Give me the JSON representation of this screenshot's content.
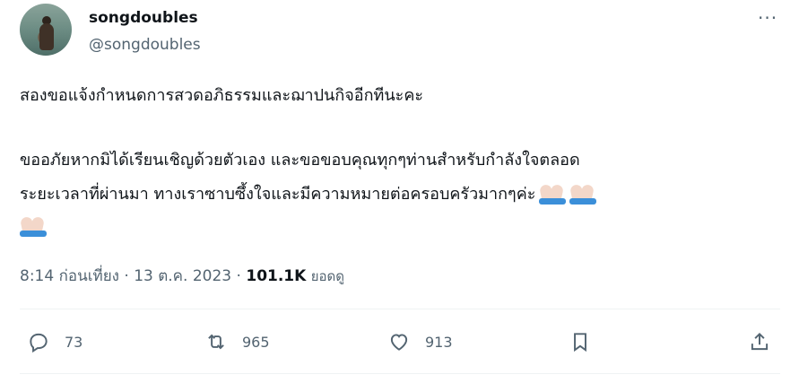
{
  "author": {
    "name": "songdoubles",
    "handle": "@songdoubles"
  },
  "tweet": {
    "line1": "สองขอแจ้งกำหนดการสวดอภิธรรมและฌาปนกิจอีกทีนะคะ",
    "line2": "ขออภัยหากมิได้เรียนเชิญด้วยตัวเอง และขอขอบคุณทุกๆท่านสำหรับกำลังใจตลอด",
    "line3": "ระยะเวลาที่ผ่านมา ทางเราซาบซึ้งใจและมีความหมายต่อครอบครัวมากๆค่ะ"
  },
  "meta": {
    "time": "8:14 ก่อนเที่ยง",
    "date": "13 ต.ค. 2023",
    "views": "101.1K",
    "views_label": "ยอดดู"
  },
  "actions": {
    "replies": "73",
    "reposts": "965",
    "likes": "913"
  },
  "icons": {
    "more": "more-horizontal-icon",
    "reply": "reply-icon",
    "repost": "repost-icon",
    "like": "heart-icon",
    "bookmark": "bookmark-icon",
    "share": "share-icon",
    "emoji": "folded-hands-emoji"
  },
  "colors": {
    "text": "#0f1419",
    "secondary": "#536471",
    "divider": "#eff3f4"
  }
}
